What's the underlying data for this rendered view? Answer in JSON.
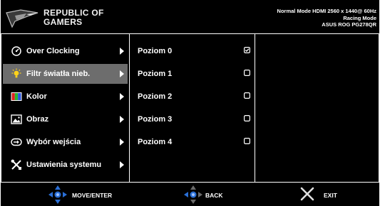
{
  "header": {
    "brand_line1": "REPUBLIC OF",
    "brand_line2": "GAMERS",
    "status_line1": "Normal Mode HDMI 2560 x 1440@ 60Hz",
    "status_line2": "Racing Mode",
    "status_line3": "ASUS ROG PG278QR",
    "logo_icon": "rog-eye-logo"
  },
  "menu": {
    "selected_index": 1,
    "items": [
      {
        "label": "Over Clocking",
        "icon": "gauge-icon"
      },
      {
        "label": "Filtr światła nieb.",
        "icon": "bulb-icon"
      },
      {
        "label": "Kolor",
        "icon": "color-icon"
      },
      {
        "label": "Obraz",
        "icon": "image-icon"
      },
      {
        "label": "Wybór wejścia",
        "icon": "input-icon"
      },
      {
        "label": "Ustawienia systemu",
        "icon": "tools-icon"
      }
    ]
  },
  "options": {
    "items": [
      {
        "label": "Poziom 0",
        "checked": true
      },
      {
        "label": "Poziom 1",
        "checked": false
      },
      {
        "label": "Poziom 2",
        "checked": false
      },
      {
        "label": "Poziom 3",
        "checked": false
      },
      {
        "label": "Poziom 4",
        "checked": false
      }
    ]
  },
  "footer": {
    "move_label": "MOVE/ENTER",
    "back_label": "BACK",
    "exit_label": "EXIT"
  },
  "colors": {
    "background": "#000000",
    "selected_bg": "#6d6d6d",
    "nav_blue": "#2a6fd6",
    "exit_x": "#e0e0e0"
  }
}
